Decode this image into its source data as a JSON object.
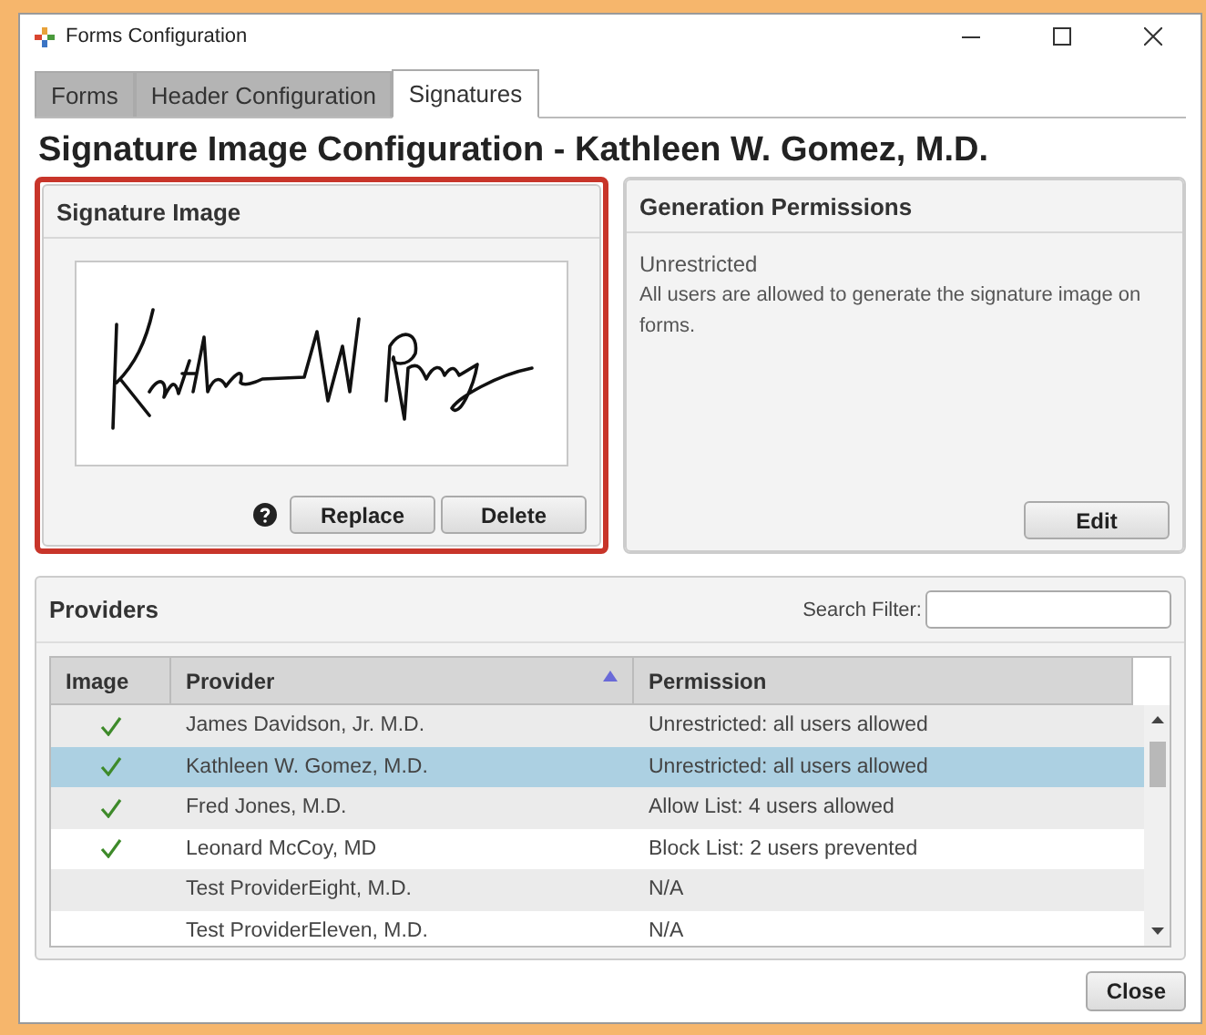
{
  "window": {
    "title": "Forms Configuration"
  },
  "tabs": [
    {
      "label": "Forms",
      "selected": false
    },
    {
      "label": "Header Configuration",
      "selected": false
    },
    {
      "label": "Signatures",
      "selected": true
    }
  ],
  "heading": "Signature Image Configuration - Kathleen W. Gomez, M.D.",
  "signature_panel": {
    "title": "Signature Image",
    "highlighted": true,
    "buttons": [
      "Replace",
      "Delete"
    ]
  },
  "permissions_panel": {
    "title": "Generation Permissions",
    "status": "Unrestricted",
    "description": "All users are allowed to generate the signature image on forms.",
    "button": "Edit"
  },
  "providers": {
    "title": "Providers",
    "search_label": "Search Filter:",
    "columns": [
      {
        "label": "Image",
        "sorted": false
      },
      {
        "label": "Provider",
        "sorted": true
      },
      {
        "label": "Permission",
        "sorted": false
      }
    ],
    "rows": [
      {
        "has_image": true,
        "provider": "James Davidson, Jr. M.D.",
        "permission": "Unrestricted: all users allowed",
        "selected": false
      },
      {
        "has_image": true,
        "provider": "Kathleen W. Gomez, M.D.",
        "permission": "Unrestricted: all users allowed",
        "selected": true
      },
      {
        "has_image": true,
        "provider": "Fred Jones, M.D.",
        "permission": "Allow List: 4 users allowed",
        "selected": false
      },
      {
        "has_image": true,
        "provider": "Leonard McCoy, MD",
        "permission": "Block List: 2 users prevented",
        "selected": false
      },
      {
        "has_image": false,
        "provider": "Test ProviderEight, M.D.",
        "permission": "N/A",
        "selected": false
      },
      {
        "has_image": false,
        "provider": "Test ProviderEleven, M.D.",
        "permission": "N/A",
        "selected": false
      }
    ]
  },
  "close_button": "Close"
}
